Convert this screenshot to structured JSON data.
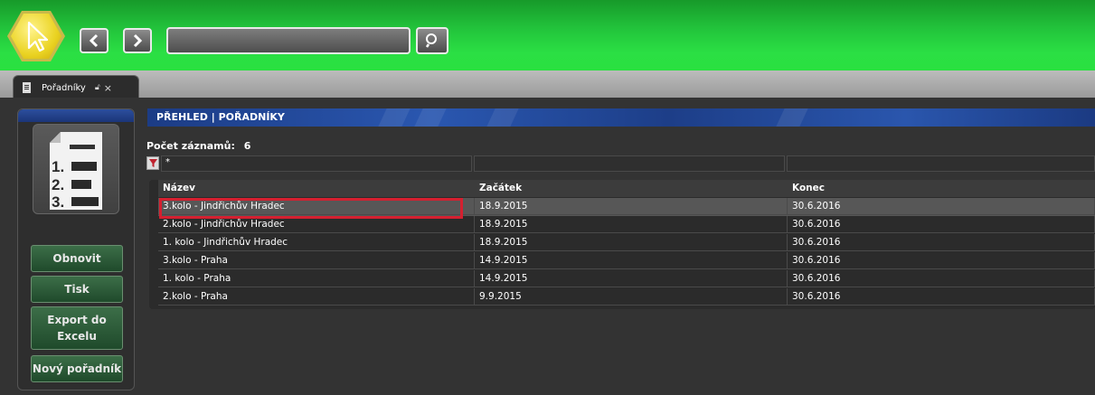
{
  "toolbar": {
    "back_icon": "chevron-left-icon",
    "forward_icon": "chevron-right-icon",
    "search_value": "",
    "search_icon": "search-icon",
    "logo_icon": "cursor-icon"
  },
  "tab": {
    "label": "Pořadníky",
    "close": "×"
  },
  "sidebar": {
    "buttons": [
      {
        "label": "Obnovit"
      },
      {
        "label": "Tisk"
      },
      {
        "label": "Export do Excelu"
      },
      {
        "label": "Nový pořadník"
      }
    ],
    "icon": {
      "lines": [
        "1.",
        "2.",
        "3."
      ]
    }
  },
  "main": {
    "title": "PŘEHLED | POŘADNÍKY",
    "count_label": "Počet záznamů:",
    "count_value": "6",
    "filter": [
      "*",
      "",
      ""
    ],
    "columns": [
      "Název",
      "Začátek",
      "Konec"
    ],
    "rows": [
      [
        "3.kolo - Jindřichův Hradec",
        "18.9.2015",
        "30.6.2016"
      ],
      [
        "2.kolo - Jindřichův Hradec",
        "18.9.2015",
        "30.6.2016"
      ],
      [
        "1. kolo - Jindřichův Hradec",
        "18.9.2015",
        "30.6.2016"
      ],
      [
        "3.kolo - Praha",
        "14.9.2015",
        "30.6.2016"
      ],
      [
        "1. kolo - Praha",
        "14.9.2015",
        "30.6.2016"
      ],
      [
        "2.kolo - Praha",
        "9.9.2015",
        "30.6.2016"
      ]
    ]
  },
  "colors": {
    "topbar": "#2ae040",
    "title_bar": "#1c3c85",
    "highlight": "#d42030",
    "side_button": "#2f5c3a"
  }
}
